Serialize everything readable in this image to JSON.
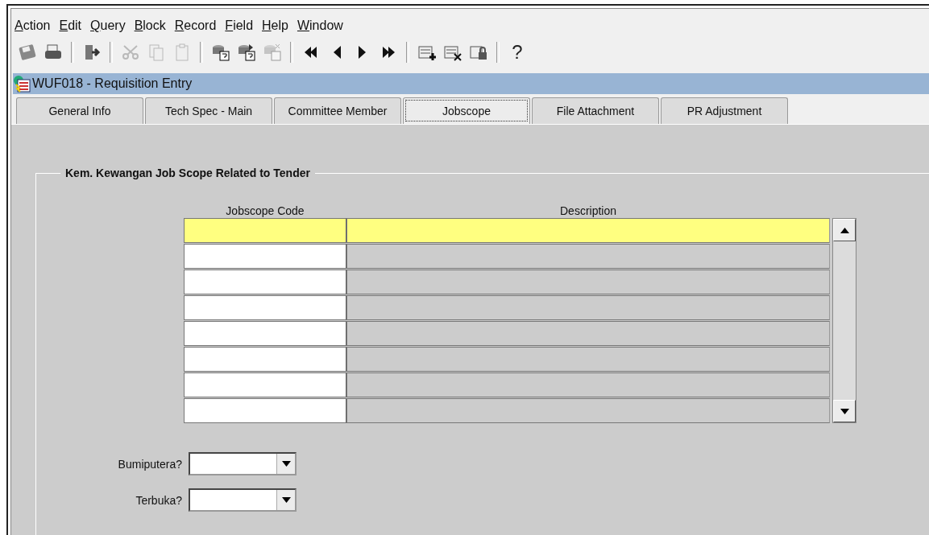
{
  "menu": [
    "Action",
    "Edit",
    "Query",
    "Block",
    "Record",
    "Field",
    "Help",
    "Window"
  ],
  "toolbar": [
    {
      "kind": "save",
      "disabled": false
    },
    {
      "kind": "print",
      "disabled": false
    },
    {
      "kind": "sep"
    },
    {
      "kind": "exit",
      "disabled": false
    },
    {
      "kind": "sep"
    },
    {
      "kind": "cut",
      "disabled": true
    },
    {
      "kind": "copy",
      "disabled": true
    },
    {
      "kind": "paste",
      "disabled": true
    },
    {
      "kind": "sep"
    },
    {
      "kind": "query",
      "disabled": false
    },
    {
      "kind": "execute",
      "disabled": false
    },
    {
      "kind": "cancel",
      "disabled": true
    },
    {
      "kind": "sep"
    },
    {
      "kind": "first",
      "disabled": false
    },
    {
      "kind": "prev",
      "disabled": false
    },
    {
      "kind": "next",
      "disabled": false
    },
    {
      "kind": "last",
      "disabled": false
    },
    {
      "kind": "sep"
    },
    {
      "kind": "insert",
      "disabled": false
    },
    {
      "kind": "delete",
      "disabled": false
    },
    {
      "kind": "lock",
      "disabled": false
    },
    {
      "kind": "sep"
    },
    {
      "kind": "help",
      "label": "?",
      "disabled": false
    }
  ],
  "window": {
    "title": "WUF018 - Requisition Entry"
  },
  "tabs": [
    {
      "label": "General Info",
      "selected": false
    },
    {
      "label": "Tech Spec - Main",
      "selected": false
    },
    {
      "label": "Committee Member",
      "selected": false
    },
    {
      "label": "Jobscope",
      "selected": true
    },
    {
      "label": "File Attachment",
      "selected": false
    },
    {
      "label": "PR Adjustment",
      "selected": false
    }
  ],
  "group": {
    "title": "Kem. Kewangan Job Scope Related to Tender"
  },
  "table": {
    "columns": [
      "Jobscope Code",
      "Description"
    ],
    "rows": [
      {
        "selected": true
      },
      {
        "selected": false
      },
      {
        "selected": false
      },
      {
        "selected": false
      },
      {
        "selected": false
      },
      {
        "selected": false
      },
      {
        "selected": false
      },
      {
        "selected": false
      }
    ]
  },
  "fields": [
    {
      "label": "Bumiputera?"
    },
    {
      "label": "Terbuka?"
    }
  ]
}
